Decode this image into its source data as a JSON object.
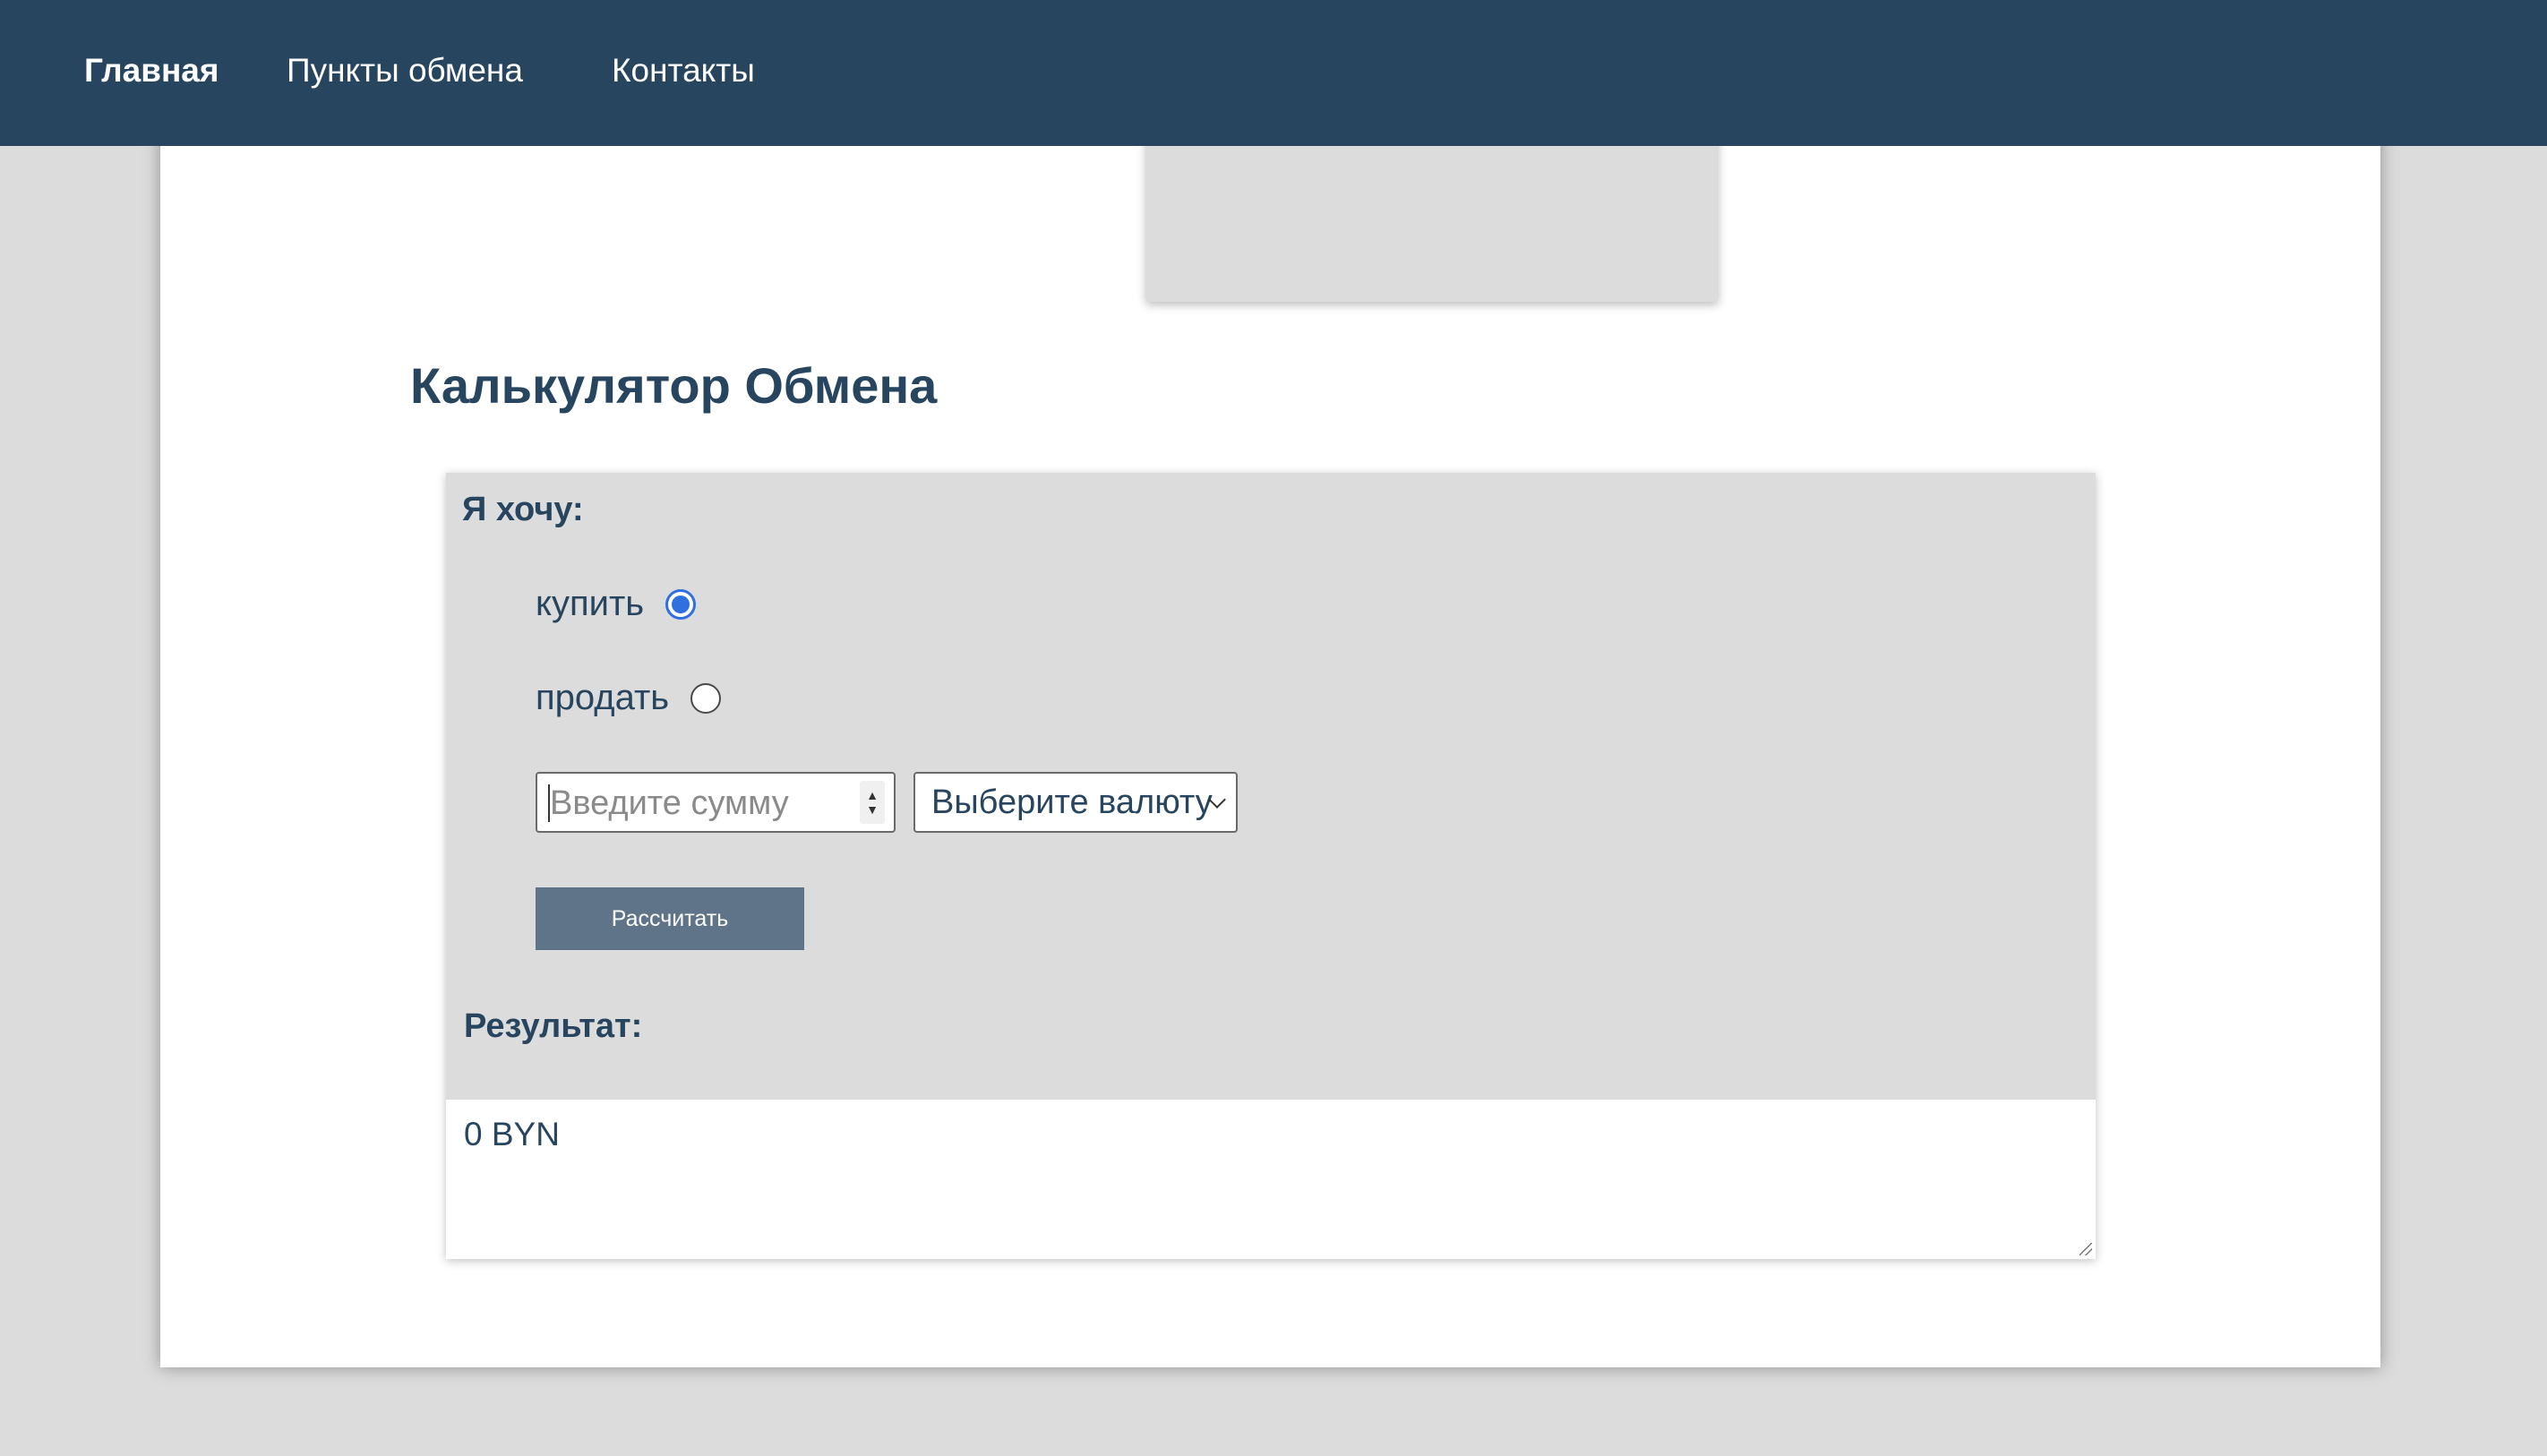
{
  "nav": {
    "items": [
      {
        "label": "Главная",
        "active": true
      },
      {
        "label": "Пункты обмена",
        "active": false
      },
      {
        "label": "Контакты",
        "active": false
      }
    ]
  },
  "page": {
    "title": "Калькулятор Обмена"
  },
  "calculator": {
    "want_label": "Я хочу:",
    "options": [
      {
        "label": "купить",
        "checked": true
      },
      {
        "label": "продать",
        "checked": false
      }
    ],
    "amount": {
      "value": "",
      "placeholder": "Введите сумму"
    },
    "currency": {
      "selected": "Выберите валюту"
    },
    "button_label": "Рассчитать",
    "result_label": "Результат:",
    "result_value": "0 BYN"
  },
  "colors": {
    "navbar": "#27455f",
    "text": "#27455f",
    "button": "#5f7489",
    "panel": "#dcdcdc",
    "radio_accent": "#2f6fe0"
  }
}
